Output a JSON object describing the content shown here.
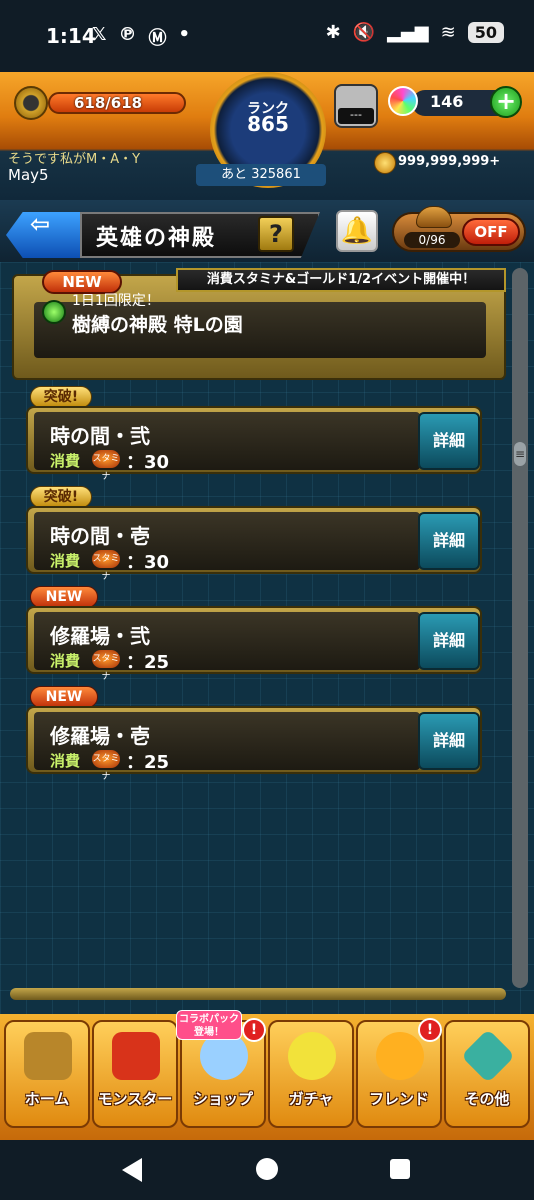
{
  "status_bar": {
    "time": "1:14",
    "left_icons": [
      "𝕏",
      "℗",
      "Ⓜ",
      "•"
    ],
    "right_icons": [
      "✱",
      "🔇",
      "▂▄▆",
      "≋"
    ],
    "battery": "50"
  },
  "header": {
    "stamina": "618/618",
    "rank_label": "ランク",
    "rank_value": "865",
    "next_exp": "あと 325861",
    "speaker_label": "---",
    "orb_count": "146",
    "plus": "+",
    "user_sub": "そうです私がM・A・Y",
    "user_name": "May5",
    "coins": "999,999,999+"
  },
  "titlebar": {
    "back": "⇦",
    "title": "英雄の神殿",
    "help": "?",
    "bell": "🔔",
    "off_count": "0/96",
    "off_label": "OFF"
  },
  "main": {
    "event_banner": "消費スタミナ&ゴールド1/2イベント開催中！",
    "featured": {
      "tag": "NEW",
      "sub": "1日1回限定！",
      "title": "樹縛の神殿 特Lの園"
    },
    "quests": [
      {
        "tag": "突破!",
        "tag_type": "breach",
        "name": "時の間・弐",
        "cost_label": "消費",
        "stamina_icon": "スタミナ",
        "cost": "：30",
        "detail": "詳細"
      },
      {
        "tag": "突破!",
        "tag_type": "breach",
        "name": "時の間・壱",
        "cost_label": "消費",
        "stamina_icon": "スタミナ",
        "cost": "：30",
        "detail": "詳細"
      },
      {
        "tag": "NEW",
        "tag_type": "new",
        "name": "修羅場・弐",
        "cost_label": "消費",
        "stamina_icon": "スタミナ",
        "cost": "：25",
        "detail": "詳細"
      },
      {
        "tag": "NEW",
        "tag_type": "new",
        "name": "修羅場・壱",
        "cost_label": "消費",
        "stamina_icon": "スタミナ",
        "cost": "：25",
        "detail": "詳細"
      }
    ],
    "scroll_thumb": "≡"
  },
  "tabbar": {
    "collab_tag": "コラボパック 登場！",
    "tabs": [
      {
        "label": "ホーム",
        "icon": "home-icon",
        "color": "#b8862a",
        "badge": ""
      },
      {
        "label": "モンスター",
        "icon": "monster-icon",
        "color": "#d8331a",
        "badge": ""
      },
      {
        "label": "ショップ",
        "icon": "shop-orb-icon",
        "color": "#9ad0ff",
        "badge": "!"
      },
      {
        "label": "ガチャ",
        "icon": "gacha-egg-icon",
        "color": "#f2e23a",
        "badge": ""
      },
      {
        "label": "フレンド",
        "icon": "friend-icon",
        "color": "#ffb020",
        "badge": "!"
      },
      {
        "label": "その他",
        "icon": "other-icon",
        "color": "#3ab0a0",
        "badge": ""
      }
    ]
  }
}
